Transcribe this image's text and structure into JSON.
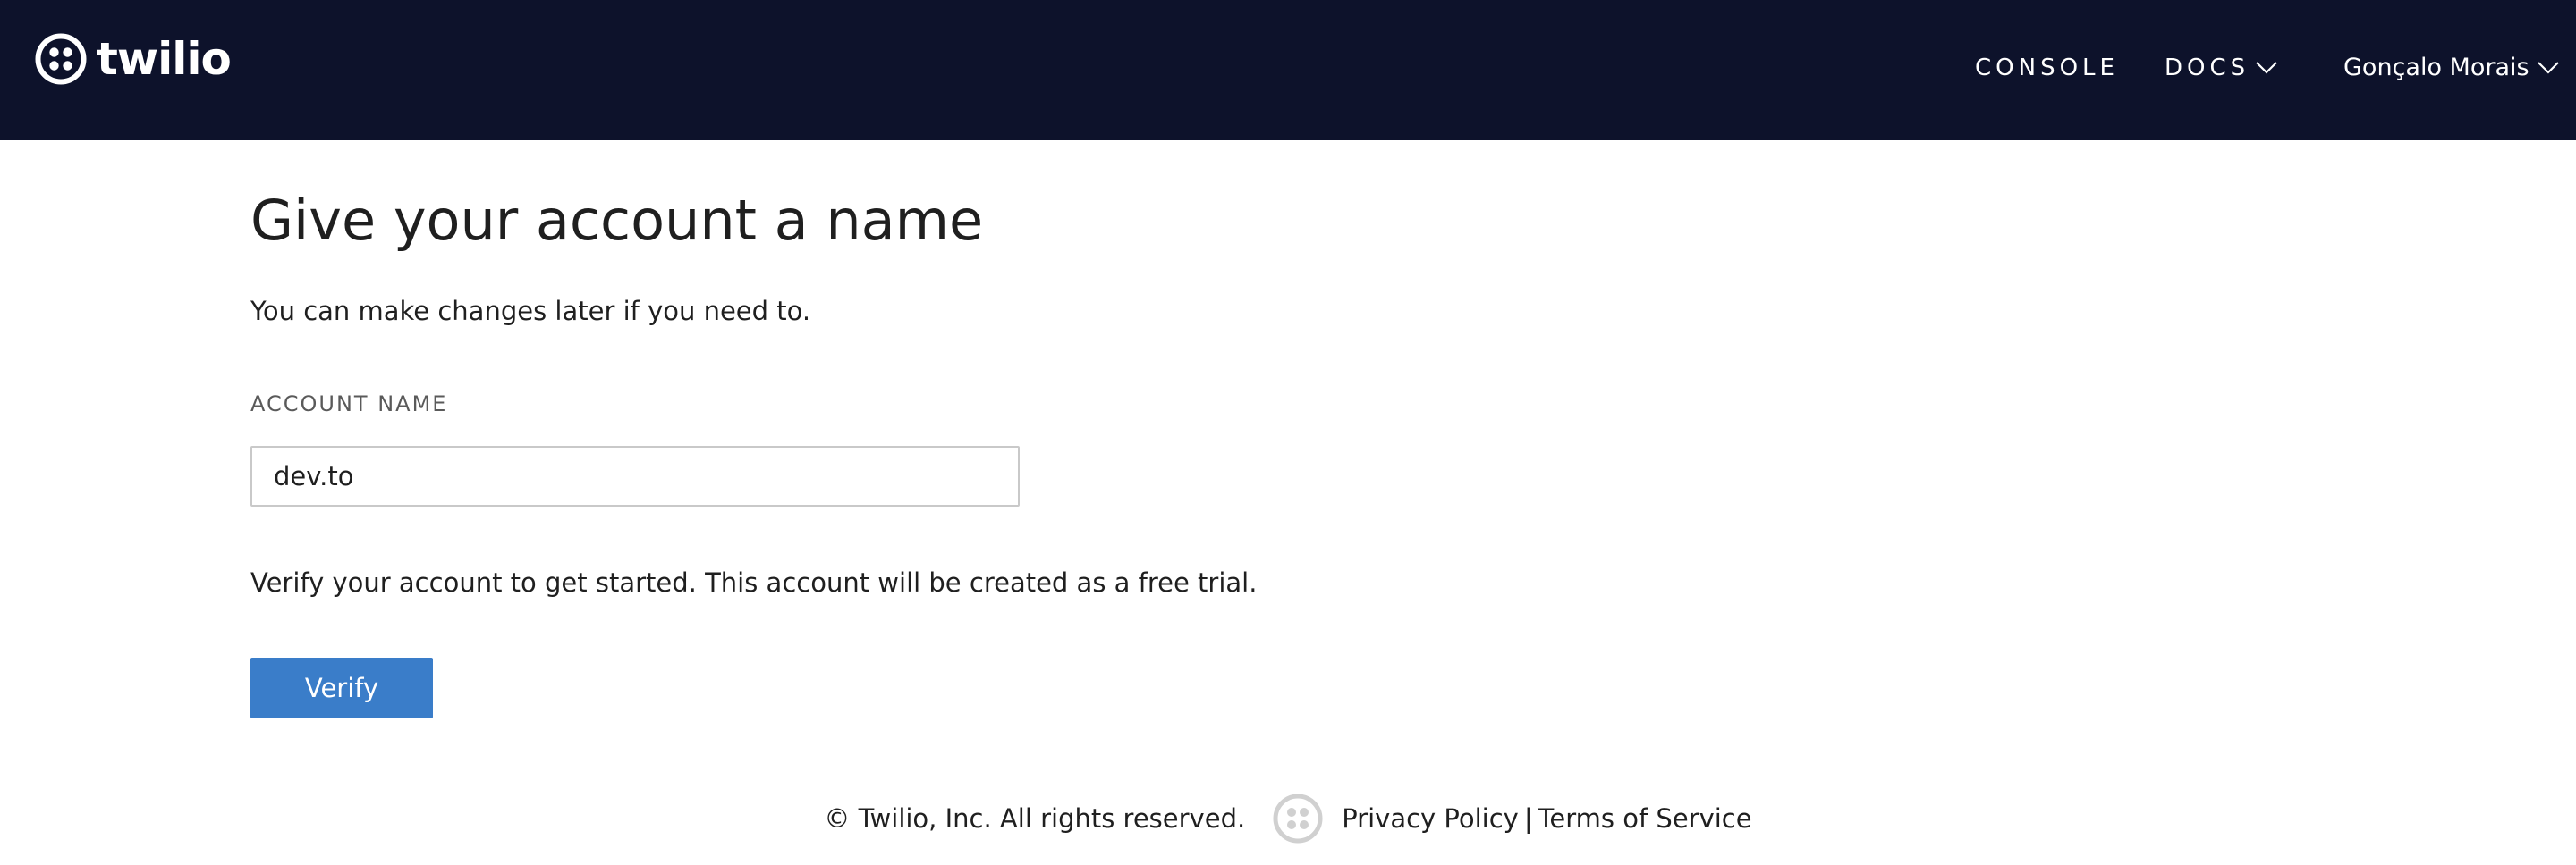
{
  "header": {
    "logo_text": "twilio",
    "logo_icon": "twilio-logo-icon",
    "background_color": "#0d122b",
    "nav": {
      "console_label": "CONSOLE",
      "docs_label": "DOCS",
      "user_label": "Gonçalo Morais"
    }
  },
  "main": {
    "title": "Give your account a name",
    "subtitle": "You can make changes later if you need to.",
    "field_label": "ACCOUNT NAME",
    "account_name_value": "dev.to",
    "verify_text": "Verify your account to get started. This account will be created as a free trial.",
    "verify_button_label": "Verify",
    "accent_color": "#3a7dc9"
  },
  "footer": {
    "copyright": "© Twilio, Inc. All rights reserved.",
    "icon": "twilio-footer-icon",
    "privacy_label": "Privacy Policy",
    "separator": "|",
    "terms_label": "Terms of Service"
  }
}
